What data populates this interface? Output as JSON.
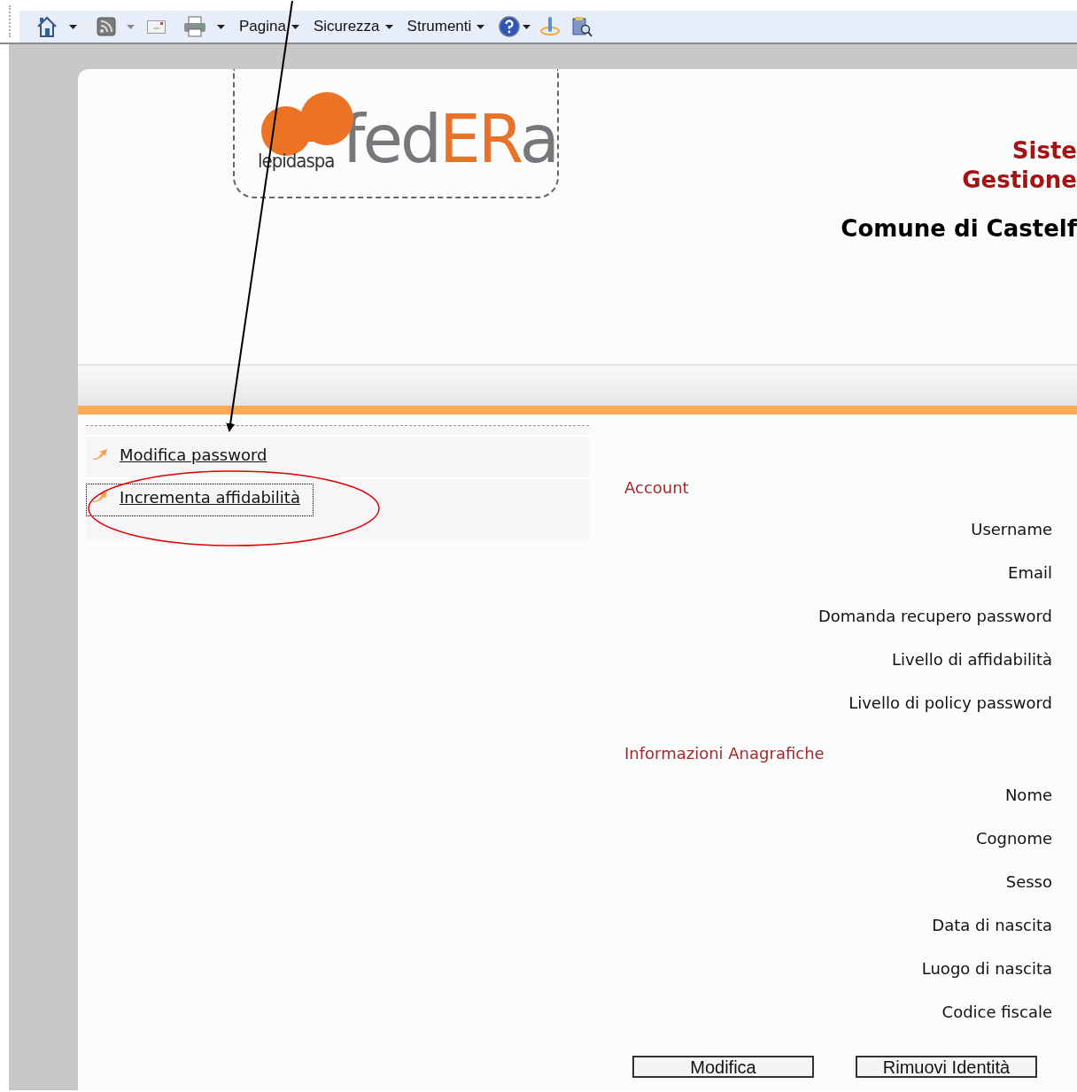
{
  "toolbar": {
    "menus": [
      {
        "label": "Pagina"
      },
      {
        "label": "Sicurezza"
      },
      {
        "label": "Strumenti"
      }
    ]
  },
  "header": {
    "logo": {
      "company": "lepidaspa",
      "name_parts": [
        {
          "text": "fed",
          "color": "#77787b"
        },
        {
          "text": "ER",
          "color": "#e8722a"
        },
        {
          "text": "a",
          "color": "#77787b"
        }
      ]
    },
    "title_lines": [
      "Siste",
      "Gestione"
    ],
    "organization": "Comune di Castelf"
  },
  "menu": {
    "items": [
      {
        "label": "Modifica password",
        "focused": false
      },
      {
        "label": "Incrementa affidabilità",
        "focused": true
      }
    ]
  },
  "sections": [
    {
      "title": "Account",
      "fields": [
        {
          "label": "Username"
        },
        {
          "label": "Email"
        },
        {
          "label": "Domanda recupero password"
        },
        {
          "label": "Livello di affidabilità"
        },
        {
          "label": "Livello di policy password"
        }
      ]
    },
    {
      "title": "Informazioni Anagrafiche",
      "fields": [
        {
          "label": "Nome"
        },
        {
          "label": "Cognome"
        },
        {
          "label": "Sesso"
        },
        {
          "label": "Data di nascita"
        },
        {
          "label": "Luogo di nascita"
        },
        {
          "label": "Codice fiscale"
        }
      ]
    }
  ],
  "buttons": [
    "Modifica",
    "Rimuovi Identità"
  ]
}
